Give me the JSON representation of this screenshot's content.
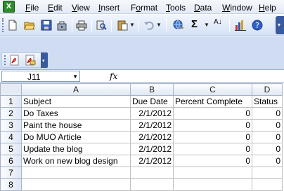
{
  "menubar": {
    "items": [
      {
        "key": "F",
        "rest": "ile"
      },
      {
        "key": "E",
        "rest": "dit"
      },
      {
        "key": "V",
        "rest": "iew"
      },
      {
        "key": "I",
        "rest": "nsert"
      },
      {
        "key": "",
        "rest": "Format"
      },
      {
        "key": "T",
        "rest": "ools"
      },
      {
        "key": "D",
        "rest": "ata"
      },
      {
        "key": "W",
        "rest": "indow"
      },
      {
        "key": "H",
        "rest": "elp"
      }
    ],
    "format_key": "o"
  },
  "formula_bar": {
    "name_box": "J11",
    "fx_label": "fx",
    "content": ""
  },
  "sheet": {
    "columns": [
      "A",
      "B",
      "C",
      "D"
    ],
    "rows": [
      {
        "num": "1",
        "cells": [
          "Subject",
          "Due Date",
          "Percent Complete",
          "Status"
        ]
      },
      {
        "num": "2",
        "cells": [
          "Do Taxes",
          "2/1/2012",
          "0",
          "0"
        ]
      },
      {
        "num": "3",
        "cells": [
          "Paint the house",
          "2/1/2012",
          "0",
          "0"
        ]
      },
      {
        "num": "4",
        "cells": [
          "Do MUO Article",
          "2/1/2012",
          "0",
          "0"
        ]
      },
      {
        "num": "5",
        "cells": [
          "Update the blog",
          "2/1/2012",
          "0",
          "0"
        ]
      },
      {
        "num": "6",
        "cells": [
          "Work on new blog design",
          "2/1/2012",
          "0",
          "0"
        ]
      },
      {
        "num": "7",
        "cells": [
          "",
          "",
          "",
          ""
        ]
      },
      {
        "num": "8",
        "cells": [
          "",
          "",
          "",
          ""
        ]
      }
    ]
  },
  "toolbar": {
    "sigma": "Σ",
    "sort": "A↓"
  }
}
